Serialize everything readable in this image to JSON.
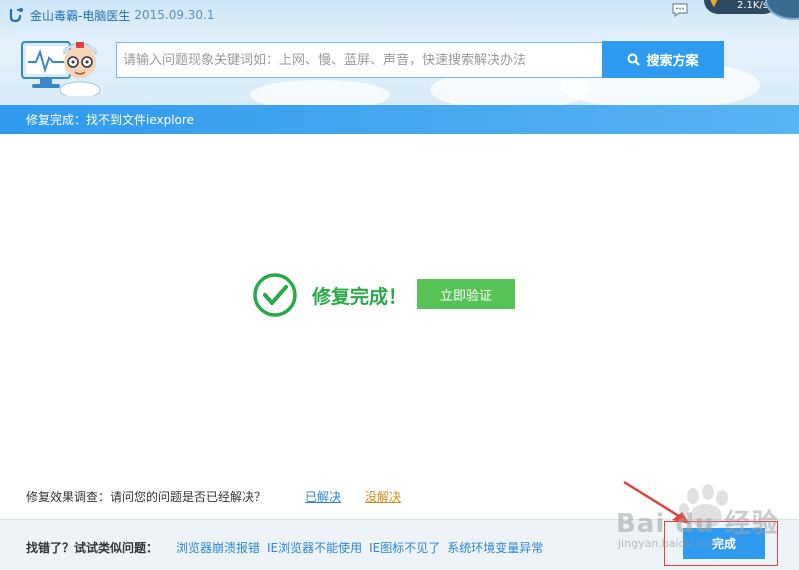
{
  "window": {
    "app_name": "金山毒霸-电脑医生",
    "version": "2015.09.30.1",
    "net_speed": "2.1K/s"
  },
  "search": {
    "placeholder": "请输入问题现象关键词如：上网、慢、蓝屏、声音，快速搜索解决办法",
    "button_label": "搜索方案"
  },
  "status": {
    "text": "修复完成：找不到文件iexplore"
  },
  "result": {
    "text": "修复完成！",
    "verify_label": "立即验证"
  },
  "survey": {
    "question": "修复效果调查：请问您的问题是否已经解决？",
    "yes_label": "已解决",
    "no_label": "没解决"
  },
  "footer": {
    "label": "找错了？试试类似问题：",
    "related": [
      "浏览器崩溃报错",
      "IE浏览器不能使用",
      "IE图标不见了",
      "系统环境变量异常"
    ],
    "done_label": "完成"
  },
  "watermark": {
    "text": "Bai du 经验",
    "sub": "jingyan.baidu.com"
  },
  "colors": {
    "accent": "#2f9bf0",
    "success": "#2aa84a",
    "verify_button": "#57c356",
    "annotation": "#e0433a"
  }
}
